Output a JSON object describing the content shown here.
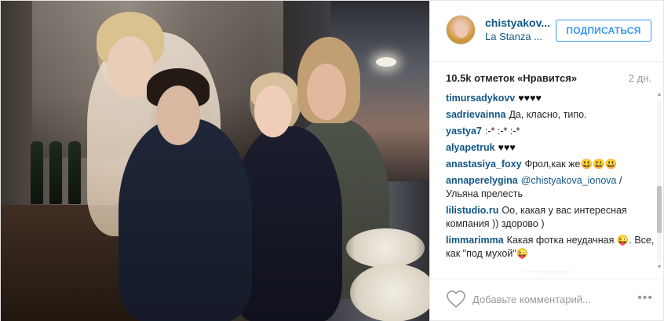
{
  "header": {
    "username": "chistyakov...",
    "location": "La Stanza ...",
    "follow_label": "ПОДПИСАТЬСЯ"
  },
  "stats": {
    "likes": "10.5k отметок «Нравится»",
    "time_ago": "2 дн."
  },
  "comments": [
    {
      "author": "timursadykovv",
      "text": "♥♥♥♥"
    },
    {
      "author": "sadrievainna",
      "text": "Да, класно, типо."
    },
    {
      "author": "yastya7",
      "text": ":-* :-* :-*"
    },
    {
      "author": "alyapetruk",
      "text": "♥♥♥"
    },
    {
      "author": "anastasiya_foxy",
      "text": "Фрол,как же😃😃😃"
    },
    {
      "author": "annaperelygina",
      "mention": "@chistyakova_ionova",
      "text": "/ Ульяна прелесть"
    },
    {
      "author": "lilistudio.ru",
      "text": "Оо, какая у вас интересная компания )) здорово )"
    },
    {
      "author": "limmarimma",
      "text": "Какая фотка неудачная 😜. Все, как \"под мухой\"😜"
    }
  ],
  "composer": {
    "placeholder": "Добавьте комментарий...",
    "like_icon": "heart-outline-icon",
    "more_icon": "more-options-icon"
  },
  "colors": {
    "link": "#125688",
    "button_blue": "#3897f0",
    "muted": "#999999"
  }
}
